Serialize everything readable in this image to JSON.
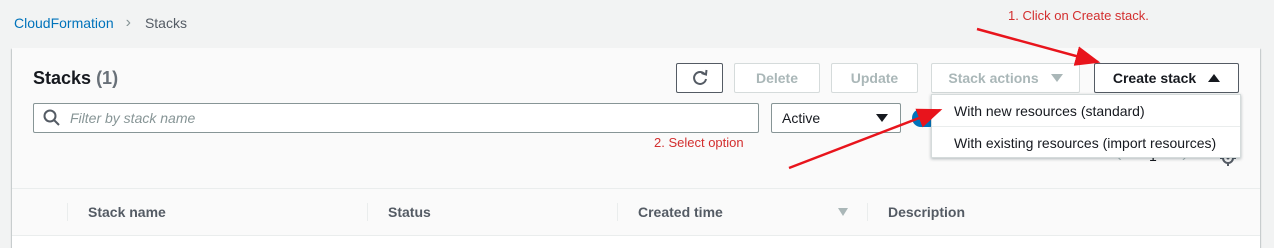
{
  "breadcrumb": {
    "root": "CloudFormation",
    "current": "Stacks"
  },
  "header": {
    "title": "Stacks",
    "count": "(1)"
  },
  "toolbar": {
    "delete_label": "Delete",
    "update_label": "Update",
    "stack_actions_label": "Stack actions",
    "create_stack_label": "Create stack"
  },
  "filter": {
    "placeholder": "Filter by stack name",
    "status_value": "Active"
  },
  "create_menu": {
    "items": [
      "With new resources (standard)",
      "With existing resources (import resources)"
    ]
  },
  "pagination": {
    "page": "1"
  },
  "table": {
    "columns": [
      "Stack name",
      "Status",
      "Created time",
      "Description"
    ]
  },
  "annotations": {
    "step1": "1. Click on Create stack.",
    "step2": "2. Select option"
  },
  "colors": {
    "link": "#0073bb",
    "annotation": "#d32f2f",
    "toggle": "#0073bb"
  },
  "icons": {
    "refresh": "refresh-icon",
    "search": "search-icon",
    "settings": "gear-icon"
  }
}
